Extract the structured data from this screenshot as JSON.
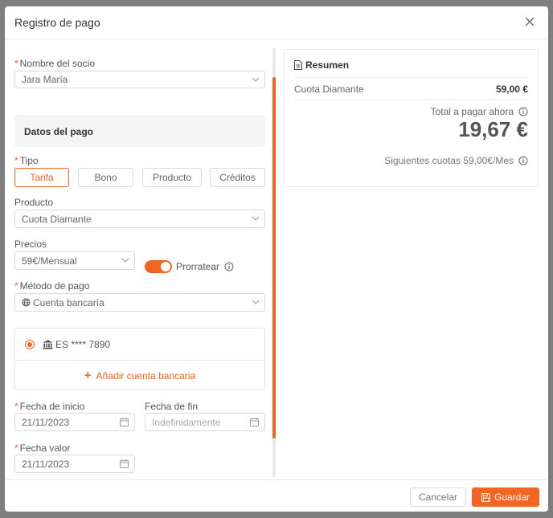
{
  "modal": {
    "title": "Registro de pago"
  },
  "form": {
    "socio": {
      "label": "Nombre del socio",
      "value": "Jara María"
    },
    "section_title": "Datos del pago",
    "tipo": {
      "label": "Tipo",
      "options": [
        "Tarifa",
        "Bono",
        "Producto",
        "Créditos"
      ],
      "selected": "Tarifa"
    },
    "producto": {
      "label": "Producto",
      "value": "Cuota Diamante"
    },
    "precios": {
      "label": "Precios",
      "value": "59€/Mensual"
    },
    "prorratear": {
      "label": "Prorratear",
      "enabled": true
    },
    "metodo": {
      "label": "Método de pago",
      "value": "Cuenta bancaría"
    },
    "bank_account": {
      "value": "ES **** 7890"
    },
    "add_bank": "Añadir cuenta bancaria",
    "fecha_inicio": {
      "label": "Fecha de inicio",
      "value": "21/11/2023"
    },
    "fecha_fin": {
      "label": "Fecha de fin",
      "placeholder": "Indefinidamente"
    },
    "fecha_valor": {
      "label": "Fecha valor",
      "value": "21/11/2023"
    }
  },
  "summary": {
    "title": "Resumen",
    "line_label": "Cuota Diamante",
    "line_value": "59,00 €",
    "total_label": "Total a pagar ahora",
    "total_amount": "19,67 €",
    "next_label": "Siguientes cuotas 59,00€/Mes"
  },
  "footer": {
    "cancel": "Cancelar",
    "save": "Guardar"
  },
  "colors": {
    "accent": "#f26522"
  }
}
